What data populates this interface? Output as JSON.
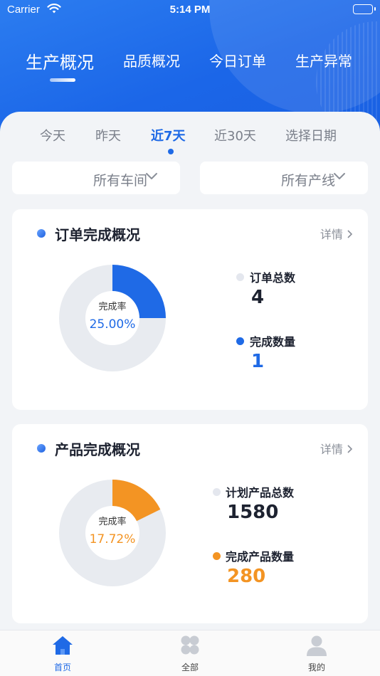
{
  "status_bar": {
    "carrier": "Carrier",
    "time": "5:14 PM"
  },
  "main_tabs": [
    {
      "label": "生产概况",
      "active": true
    },
    {
      "label": "品质概况",
      "active": false
    },
    {
      "label": "今日订单",
      "active": false
    },
    {
      "label": "生产异常",
      "active": false
    }
  ],
  "date_tabs": [
    {
      "label": "今天",
      "active": false
    },
    {
      "label": "昨天",
      "active": false
    },
    {
      "label": "近7天",
      "active": true
    },
    {
      "label": "近30天",
      "active": false
    },
    {
      "label": "选择日期",
      "active": false
    }
  ],
  "filters": {
    "workshop": "所有车间",
    "line": "所有产线"
  },
  "order_card": {
    "title": "订单完成概况",
    "more": "详情",
    "rate_label": "完成率",
    "rate_value": "25.00%",
    "rate_fraction": 0.25,
    "total_label": "订单总数",
    "total_value": "4",
    "done_label": "完成数量",
    "done_value": "1",
    "accent_color": "#1f6ae6"
  },
  "product_card": {
    "title": "产品完成概况",
    "more": "详情",
    "rate_label": "完成率",
    "rate_value": "17.72%",
    "rate_fraction": 0.1772,
    "total_label": "计划产品总数",
    "total_value": "1580",
    "done_label": "完成产品数量",
    "done_value": "280",
    "accent_color": "#f39423"
  },
  "bottom_nav": [
    {
      "label": "首页",
      "icon": "home-icon",
      "active": true
    },
    {
      "label": "全部",
      "icon": "grid-icon",
      "active": false
    },
    {
      "label": "我的",
      "icon": "user-icon",
      "active": false
    }
  ],
  "colors": {
    "primary": "#1f6ae6",
    "orange": "#f39423",
    "track": "#e8ebf0"
  }
}
